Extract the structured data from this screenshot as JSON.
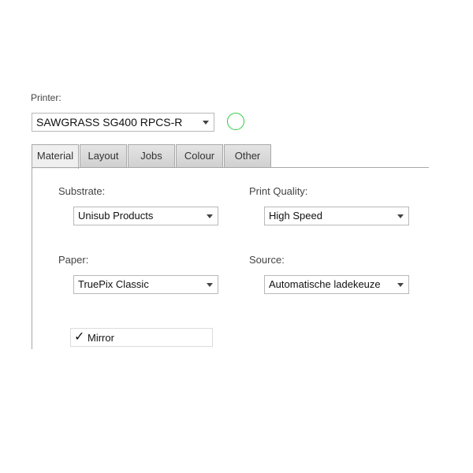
{
  "printer": {
    "label": "Printer:",
    "selected": "SAWGRASS SG400 RPCS-R",
    "status_color": "#2ecc40"
  },
  "tabs": [
    {
      "label": "Material",
      "active": true
    },
    {
      "label": "Layout",
      "active": false
    },
    {
      "label": "Jobs",
      "active": false
    },
    {
      "label": "Colour",
      "active": false
    },
    {
      "label": "Other",
      "active": false
    }
  ],
  "material": {
    "substrate": {
      "label": "Substrate:",
      "value": "Unisub Products"
    },
    "print_quality": {
      "label": "Print Quality:",
      "value": "High Speed"
    },
    "paper": {
      "label": "Paper:",
      "value": "TruePix Classic"
    },
    "source": {
      "label": "Source:",
      "value": "Automatische ladekeuze"
    },
    "mirror": {
      "label": "Mirror",
      "checked": true,
      "check_glyph": "✓"
    }
  }
}
